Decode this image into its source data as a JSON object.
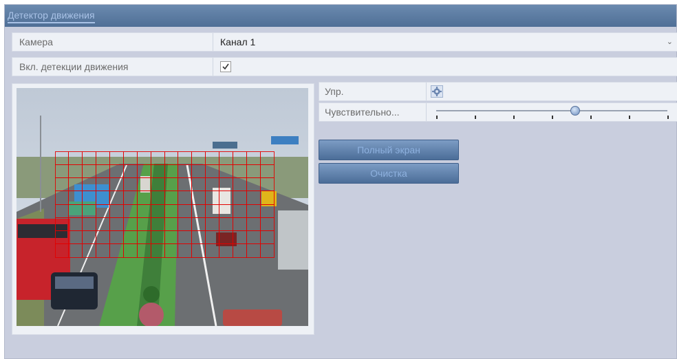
{
  "window": {
    "title": "Детектор движения"
  },
  "camera": {
    "label": "Камера",
    "value": "Канал 1"
  },
  "motion_detection": {
    "label": "Вкл. детекции движения",
    "checked": true
  },
  "settings": {
    "control_label": "Упр.",
    "sensitivity_label": "Чувствительно...",
    "sensitivity_level": 0.6,
    "sensitivity_ticks": 7
  },
  "buttons": {
    "fullscreen": "Полный экран",
    "clear": "Очистка"
  },
  "colors": {
    "grid": "#e20000",
    "accent": "#4f6f96"
  }
}
